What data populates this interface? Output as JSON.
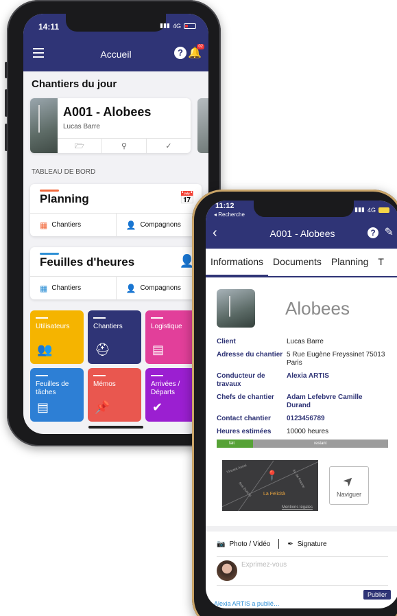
{
  "phone1": {
    "status": {
      "time": "14:11",
      "network": "4G"
    },
    "nav": {
      "title": "Accueil",
      "help": "?",
      "badge": "02"
    },
    "section_title": "Chantiers du jour",
    "chantier_card": {
      "code": "A001 - Alobees",
      "person": "Lucas Barre"
    },
    "dashboard_label": "TABLEAU DE BORD",
    "planning": {
      "title": "Planning",
      "accent": "#f26a3d",
      "left": "Chantiers",
      "right": "Compagnons"
    },
    "feuilles": {
      "title": "Feuilles d'heures",
      "accent": "#2d8fd5",
      "left": "Chantiers",
      "right": "Compagnons"
    },
    "tiles": [
      {
        "label": "Utilisateurs",
        "color": "#f5b400",
        "icon": "users-icon"
      },
      {
        "label": "Chantiers",
        "color": "#2f3476",
        "icon": "helmet-icon"
      },
      {
        "label": "Logistique",
        "color": "#e23f9a",
        "icon": "dolly-icon"
      },
      {
        "label": "Feuilles de tâches",
        "color": "#2d7fd5",
        "icon": "document-icon"
      },
      {
        "label": "Mémos",
        "color": "#e9574f",
        "icon": "pin-icon"
      },
      {
        "label": "Arrivées / Départs",
        "color": "#9b1fd1",
        "icon": "check-icon"
      }
    ]
  },
  "phone2": {
    "status": {
      "time": "11:12",
      "back": "◂ Recherche",
      "network": "4G"
    },
    "nav": {
      "title": "A001 - Alobees",
      "help": "?"
    },
    "tabs": [
      "Informations",
      "Documents",
      "Planning",
      "T"
    ],
    "client_name": "Alobees",
    "info": [
      {
        "label": "Client",
        "value": "Lucas Barre",
        "bold": false
      },
      {
        "label": "Adresse du chantier",
        "value": "5 Rue Eugène Freyssinet 75013 Paris",
        "bold": false
      },
      {
        "label": "Conducteur de travaux",
        "value": "Alexia ARTIS",
        "bold": true
      },
      {
        "label": "Chefs de chantier",
        "value": "Adam Lefebvre Camille Durand",
        "bold": true
      },
      {
        "label": "Contact chantier",
        "value": "0123456789",
        "bold": true
      },
      {
        "label": "Heures estimées",
        "value": "10000 heures",
        "bold": false
      }
    ],
    "progress": {
      "done_label": "fait",
      "rest_label": "restant",
      "done_fraction": 0.21
    },
    "map": {
      "poi": "La Felicità",
      "legal": "Mentions légales",
      "street1": "Vincent Auriol",
      "street2": "Rue Dunois",
      "street3": "Av. de France"
    },
    "navigate_label": "Naviguer",
    "feed": {
      "photo": "Photo / Vidéo",
      "signature": "Signature",
      "placeholder": "Exprimez-vous",
      "publish": "Publier",
      "bottom": "Alexia ARTIS a publié…"
    }
  }
}
